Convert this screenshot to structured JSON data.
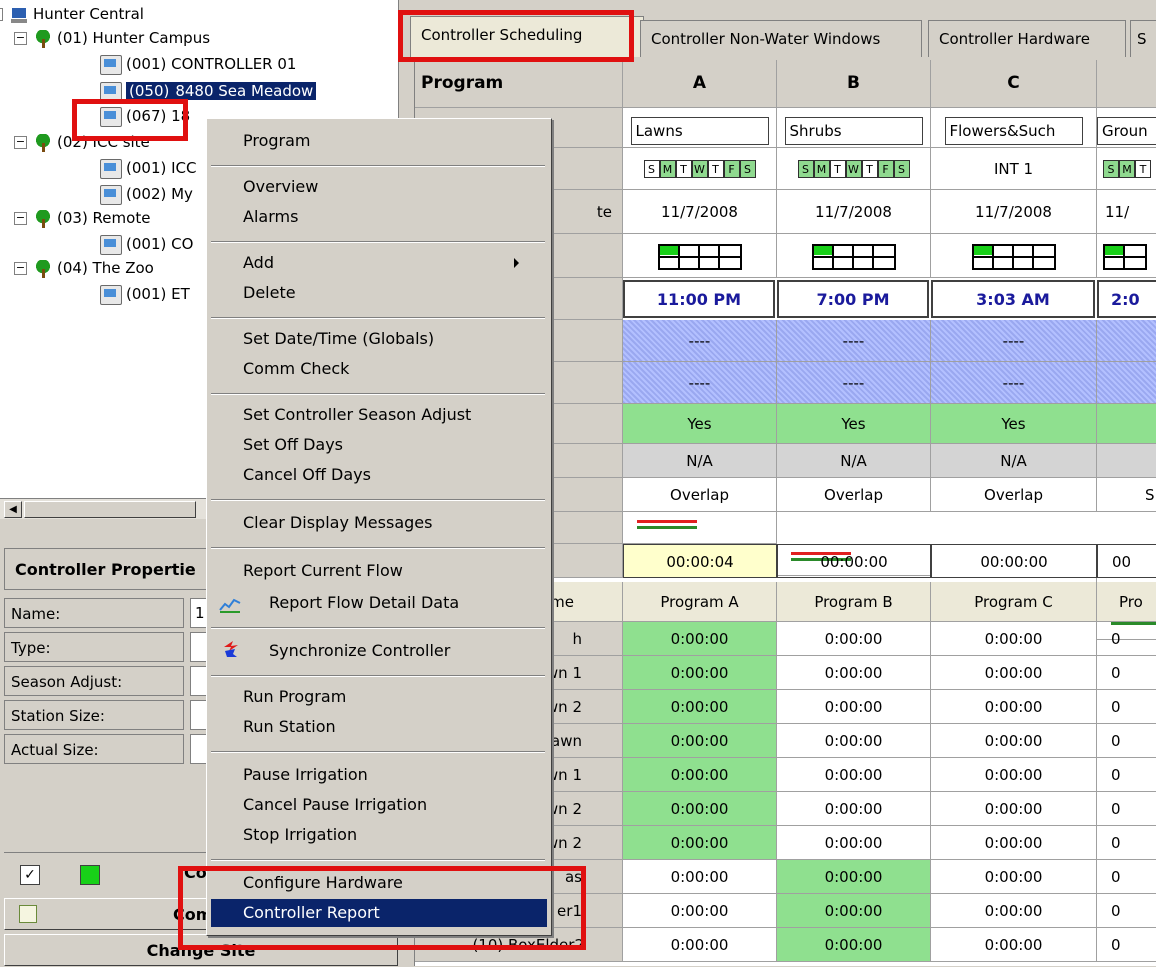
{
  "tree": {
    "root": "Hunter Central",
    "site1": "(01) Hunter Campus",
    "c1": "(001) CONTROLLER 01",
    "c2_id": "(050)",
    "c2_rest": "8480 Sea Meadow",
    "c3": "(067) 18",
    "site2": "(02) ICC site",
    "c4": "(001) ICC",
    "c5": "(002) My",
    "site3": "(03) Remote",
    "c6": "(001) CO",
    "site4": "(04) The Zoo",
    "c7": "(001) ET"
  },
  "props": {
    "title": "Controller Propertie",
    "rows": [
      "Name:",
      "Type:",
      "Season Adjust:",
      "Station Size:",
      "Actual Size:"
    ],
    "name_val": "1"
  },
  "bottom": {
    "co_label": "Co",
    "comm_label": "Comm",
    "change_site": "Change Site"
  },
  "tabs": [
    "Controller Scheduling",
    "Controller Non-Water Windows",
    "Controller Hardware",
    "S"
  ],
  "grid": {
    "program_label": "Program",
    "columns": [
      "A",
      "B",
      "C",
      ""
    ],
    "names": [
      "Lawns",
      "Shrubs",
      "Flowers&Such",
      "Groun"
    ],
    "day_letters": [
      "S",
      "M",
      "T",
      "W",
      "T",
      "F",
      "S"
    ],
    "int_label": "INT 1",
    "date_label_tail": "te",
    "dates": [
      "11/7/2008",
      "11/7/2008",
      "11/7/2008",
      "11/"
    ],
    "start_times": [
      "11:00 PM",
      "7:00 PM",
      "3:03 AM",
      "2:0"
    ],
    "dash": "----",
    "yes": "Yes",
    "na": "N/A",
    "overlap": "Overlap",
    "overlap_cut": "S",
    "durations": [
      "00:00:04",
      "00:00:00",
      "00:00:00",
      "00"
    ],
    "station_header_tail": "me",
    "program_names": [
      "Program A",
      "Program B",
      "Program C",
      "Pro"
    ],
    "station_tails": [
      "h",
      "wn 1",
      "wn 2",
      "awn",
      "wn 1",
      "wn 2",
      "wn 2",
      "as",
      "er1",
      "(10) BoxElder2"
    ],
    "run_time": "0:00:00",
    "run_time_cut": "0"
  },
  "menu": {
    "items": [
      "Program",
      "Overview",
      "Alarms",
      "Add",
      "Delete",
      "Set Date/Time (Globals)",
      "Comm Check",
      "Set Controller Season Adjust",
      "Set Off Days",
      "Cancel Off Days",
      "Clear Display Messages",
      "Report Current Flow",
      "Report Flow Detail Data",
      "Synchronize Controller",
      "Run Program",
      "Run Station",
      "Pause Irrigation",
      "Cancel Pause Irrigation",
      "Stop Irrigation",
      "Configure Hardware",
      "Controller Report"
    ]
  },
  "colors": {
    "highlight": "#0a246a",
    "annotation": "#e01010",
    "green_cell": "#8fe08f",
    "time_text": "#1a1a9c"
  }
}
